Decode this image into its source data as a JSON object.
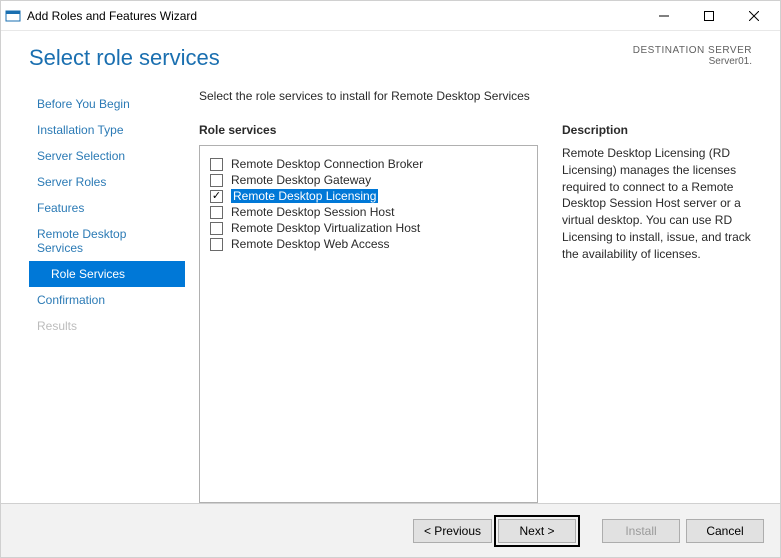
{
  "titlebar": {
    "title": "Add Roles and Features Wizard"
  },
  "header": {
    "page_title": "Select role services",
    "dest_label": "DESTINATION SERVER",
    "dest_value": "Server01."
  },
  "sidebar": {
    "items": [
      {
        "label": "Before You Begin",
        "state": "normal"
      },
      {
        "label": "Installation Type",
        "state": "normal"
      },
      {
        "label": "Server Selection",
        "state": "normal"
      },
      {
        "label": "Server Roles",
        "state": "normal"
      },
      {
        "label": "Features",
        "state": "normal"
      },
      {
        "label": "Remote Desktop Services",
        "state": "normal"
      },
      {
        "label": "Role Services",
        "state": "selected"
      },
      {
        "label": "Confirmation",
        "state": "normal"
      },
      {
        "label": "Results",
        "state": "disabled"
      }
    ]
  },
  "main": {
    "instruction": "Select the role services to install for Remote Desktop Services",
    "role_services_heading": "Role services",
    "services": [
      {
        "label": "Remote Desktop Connection Broker",
        "checked": false,
        "selected": false
      },
      {
        "label": "Remote Desktop Gateway",
        "checked": false,
        "selected": false
      },
      {
        "label": "Remote Desktop Licensing",
        "checked": true,
        "selected": true
      },
      {
        "label": "Remote Desktop Session Host",
        "checked": false,
        "selected": false
      },
      {
        "label": "Remote Desktop Virtualization Host",
        "checked": false,
        "selected": false
      },
      {
        "label": "Remote Desktop Web Access",
        "checked": false,
        "selected": false
      }
    ],
    "description_heading": "Description",
    "description_text": "Remote Desktop Licensing (RD Licensing) manages the licenses required to connect to a Remote Desktop Session Host server or a virtual desktop. You can use RD Licensing to install, issue, and track the availability of licenses."
  },
  "footer": {
    "previous": "< Previous",
    "next": "Next >",
    "install": "Install",
    "cancel": "Cancel"
  }
}
